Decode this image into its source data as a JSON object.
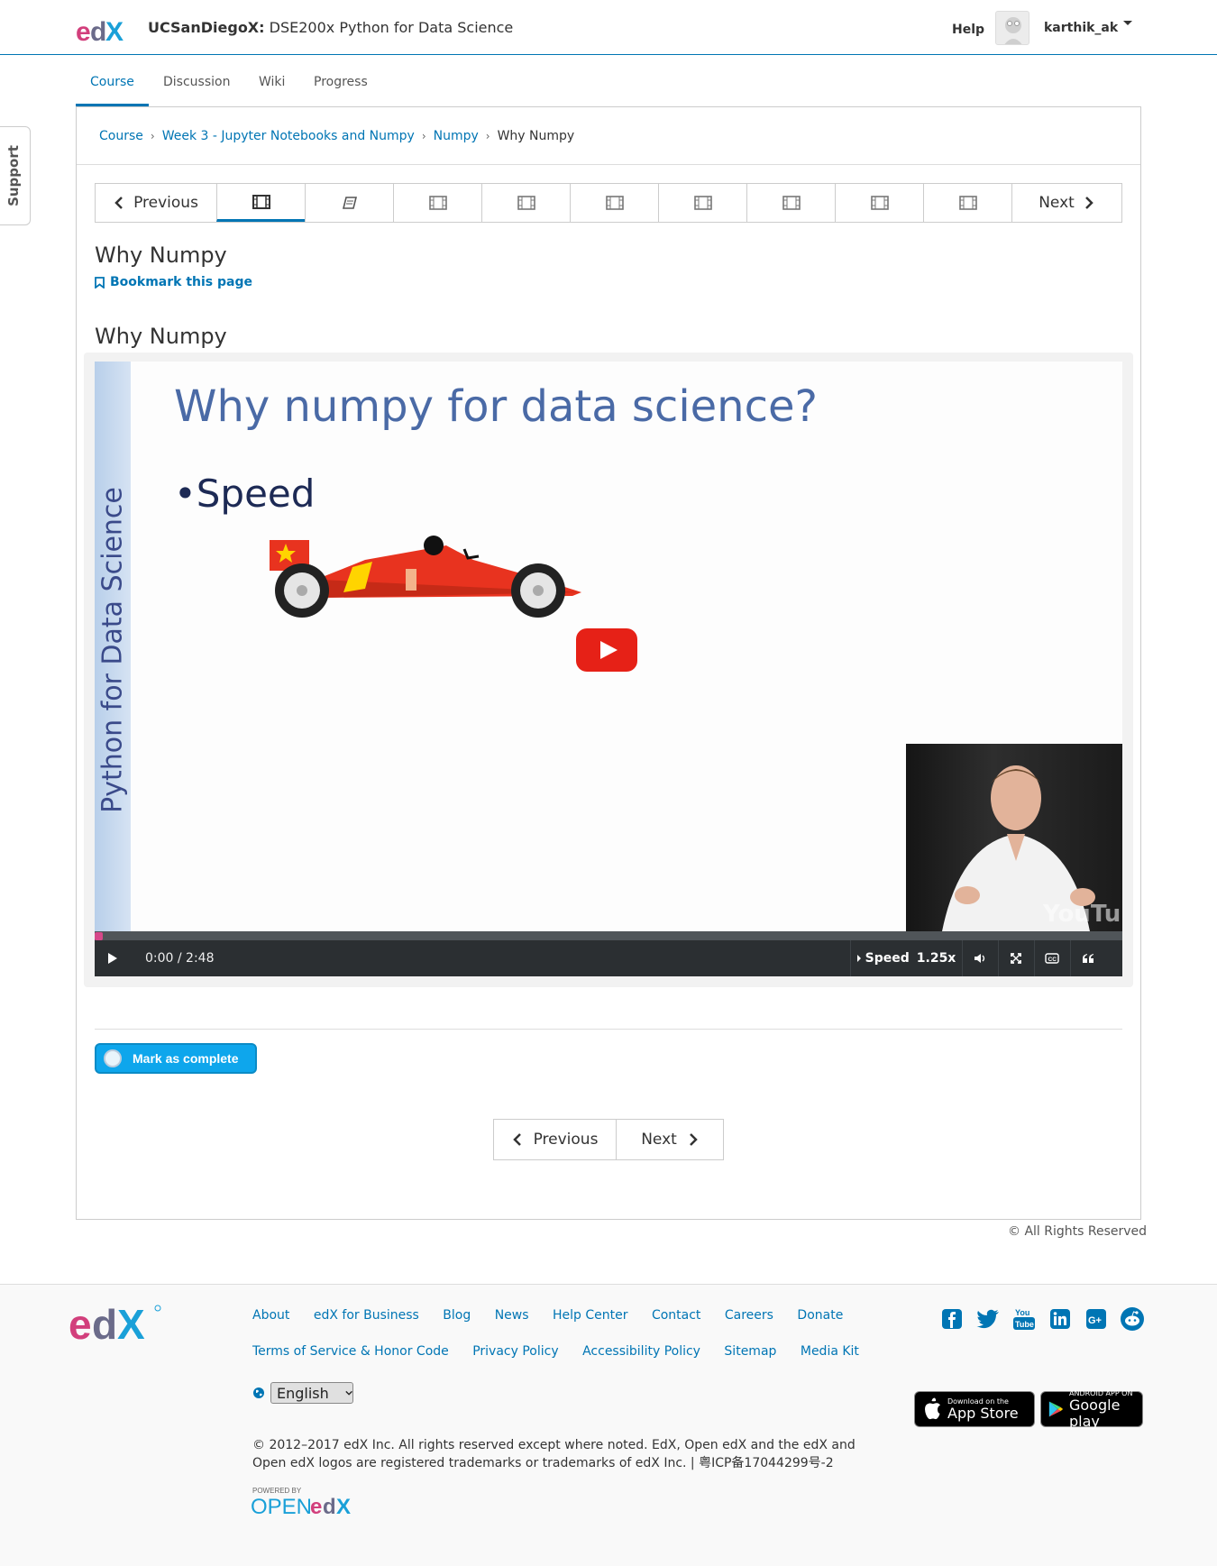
{
  "header": {
    "org": "UCSanDiegoX:",
    "course": "DSE200x Python for Data Science",
    "help": "Help",
    "username": "karthik_ak"
  },
  "tabs": [
    {
      "label": "Course",
      "active": true
    },
    {
      "label": "Discussion"
    },
    {
      "label": "Wiki"
    },
    {
      "label": "Progress"
    }
  ],
  "support_label": "Support",
  "breadcrumb": {
    "items": [
      "Course",
      "Week 3 - Jupyter Notebooks and Numpy",
      "Numpy"
    ],
    "current": "Why Numpy"
  },
  "sequence": {
    "previous": "Previous",
    "next": "Next",
    "items": [
      "video-icon",
      "book-icon",
      "video-icon",
      "video-icon",
      "video-icon",
      "video-icon",
      "video-icon",
      "video-icon",
      "video-icon"
    ],
    "active_index": 0
  },
  "unit": {
    "title": "Why Numpy",
    "bookmark": "Bookmark this page",
    "video_title": "Why Numpy"
  },
  "video": {
    "slide_heading": "Why numpy for data science?",
    "slide_bullet": "•Speed",
    "slide_sidebar": "Python for Data Science",
    "watermark": "YouTube",
    "time": "0:00 / 2:48",
    "speed_label": "Speed",
    "speed_value": "1.25x",
    "progress": 0
  },
  "complete_button": "Mark as complete",
  "bottom_nav": {
    "previous": "Previous",
    "next": "Next"
  },
  "rights": "© All Rights Reserved",
  "footer": {
    "links_row1": [
      "About",
      "edX for Business",
      "Blog",
      "News",
      "Help Center",
      "Contact",
      "Careers",
      "Donate"
    ],
    "links_row2": [
      "Terms of Service & Honor Code",
      "Privacy Policy",
      "Accessibility Policy",
      "Sitemap",
      "Media Kit"
    ],
    "language": "English",
    "copyright": "© 2012–2017 edX Inc. All rights reserved except where noted. EdX, Open edX and the edX and Open edX logos are registered trademarks or trademarks of edX Inc. | 粤ICP备17044299号-2",
    "social": [
      "facebook-icon",
      "twitter-icon",
      "youtube-icon",
      "linkedin-icon",
      "google-plus-icon",
      "reddit-icon"
    ],
    "app_store": {
      "small": "Download on the",
      "big": "App Store"
    },
    "google_play": {
      "small": "ANDROID APP ON",
      "big": "Google play"
    },
    "powered_by": "POWERED BY"
  },
  "colors": {
    "accent": "#0075b4",
    "edx_pink": "#d23f7c",
    "edx_blue": "#1aa0d8",
    "complete_button": "#0ea6ec",
    "progress_marker": "#d6488a"
  }
}
